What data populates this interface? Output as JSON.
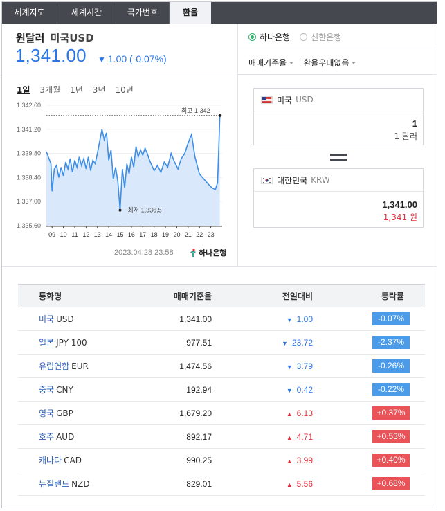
{
  "tabs": [
    {
      "label": "세계지도"
    },
    {
      "label": "세계시간"
    },
    {
      "label": "국가번호"
    },
    {
      "label": "환율"
    }
  ],
  "header": {
    "title": "원달러",
    "subtitle": "미국USD",
    "rate": "1,341.00",
    "change_arrow": "▼",
    "change": "1.00 (-0.07%)",
    "change_color": "#2b76e5"
  },
  "periods": [
    {
      "label": "1일"
    },
    {
      "label": "3개월"
    },
    {
      "label": "1년"
    },
    {
      "label": "3년"
    },
    {
      "label": "10년"
    }
  ],
  "chart_data": {
    "type": "area",
    "x_tick_labels": [
      "09",
      "10",
      "11",
      "12",
      "13",
      "14",
      "15",
      "16",
      "17",
      "18",
      "19",
      "20",
      "21",
      "22",
      "23"
    ],
    "y_tick_labels": [
      "1,342.60",
      "1,341.20",
      "1,339.80",
      "1,338.40",
      "1,337.00",
      "1,335.60"
    ],
    "ylim": [
      1335.6,
      1342.6
    ],
    "xlim": [
      8.5,
      24.0
    ],
    "max_label": "최고 1,342",
    "max_value": 1342.0,
    "min_label": "최저 1,336.5",
    "min_value": 1336.5,
    "min_x": 15.0,
    "series": [
      {
        "x": [
          8.5,
          8.9,
          9.0,
          9.2,
          9.4,
          9.6,
          9.8,
          10.0,
          10.2,
          10.4,
          10.6,
          10.8,
          11.0,
          11.2,
          11.4,
          11.6,
          11.8,
          12.0,
          12.2,
          12.4,
          12.6,
          12.8,
          13.0,
          13.2,
          13.4,
          13.6,
          13.8,
          14.0,
          14.2,
          14.4,
          14.6,
          14.8,
          15.0,
          15.2,
          15.4,
          15.6,
          15.8,
          16.0,
          16.2,
          16.4,
          16.6,
          16.8,
          17.0,
          17.2,
          17.4,
          17.6,
          17.8,
          18.0,
          18.3,
          18.6,
          18.9,
          19.2,
          19.5,
          19.8,
          20.1,
          20.4,
          20.7,
          21.0,
          21.3,
          21.6,
          22.0,
          22.4,
          22.8,
          23.1,
          23.4,
          23.6,
          23.8
        ],
        "y": [
          1339.9,
          1339.2,
          1337.6,
          1338.9,
          1339.1,
          1338.4,
          1339.0,
          1338.5,
          1339.3,
          1338.9,
          1339.5,
          1338.7,
          1339.4,
          1339.0,
          1339.6,
          1339.1,
          1339.5,
          1338.9,
          1339.6,
          1338.8,
          1339.4,
          1339.2,
          1339.8,
          1340.5,
          1341.2,
          1340.6,
          1341.0,
          1339.4,
          1340.0,
          1338.3,
          1339.0,
          1338.2,
          1336.5,
          1338.9,
          1337.8,
          1339.2,
          1338.6,
          1339.6,
          1339.0,
          1340.2,
          1339.6,
          1340.0,
          1339.7,
          1340.1,
          1339.8,
          1339.4,
          1339.1,
          1338.8,
          1339.1,
          1338.7,
          1339.3,
          1339.0,
          1339.8,
          1339.3,
          1338.9,
          1339.5,
          1339.8,
          1340.4,
          1340.9,
          1339.6,
          1338.6,
          1338.3,
          1338.0,
          1337.8,
          1337.7,
          1338.1,
          1342.0
        ]
      }
    ],
    "colors": {
      "line": "#3e8ee6",
      "fill": "#d9e9fb",
      "max_line": "#333333"
    }
  },
  "chart_footer": {
    "timestamp": "2023.04.28 23:58",
    "bank_logo": "하나은행"
  },
  "banks": [
    {
      "label": "하나은행",
      "selected": true
    },
    {
      "label": "신한은행",
      "selected": false
    }
  ],
  "selects": [
    {
      "label": "매매기준율"
    },
    {
      "label": "환율우대없음"
    }
  ],
  "converter": {
    "from": {
      "country": "미국",
      "code": "USD",
      "amount": "1",
      "unit": "1 달러",
      "flag": "us-flag"
    },
    "to": {
      "country": "대한민국",
      "code": "KRW",
      "amount": "1,341.00",
      "unit": "1,341 원",
      "flag": "kr-flag",
      "unit_color": "#e2323d"
    }
  },
  "table": {
    "headers": [
      "통화명",
      "매매기준율",
      "전일대비",
      "등락률"
    ],
    "rows": [
      {
        "name": "미국",
        "code": "USD",
        "rate": "1,341.00",
        "dir": "down",
        "arrow": "▼",
        "diff": "1.00",
        "pct": "-0.07%"
      },
      {
        "name": "일본",
        "code": "JPY 100",
        "rate": "977.51",
        "dir": "down",
        "arrow": "▼",
        "diff": "23.72",
        "pct": "-2.37%"
      },
      {
        "name": "유럽연합",
        "code": "EUR",
        "rate": "1,474.56",
        "dir": "down",
        "arrow": "▼",
        "diff": "3.79",
        "pct": "-0.26%"
      },
      {
        "name": "중국",
        "code": "CNY",
        "rate": "192.94",
        "dir": "down",
        "arrow": "▼",
        "diff": "0.42",
        "pct": "-0.22%"
      },
      {
        "name": "영국",
        "code": "GBP",
        "rate": "1,679.20",
        "dir": "up",
        "arrow": "▲",
        "diff": "6.13",
        "pct": "+0.37%"
      },
      {
        "name": "호주",
        "code": "AUD",
        "rate": "892.17",
        "dir": "up",
        "arrow": "▲",
        "diff": "4.71",
        "pct": "+0.53%"
      },
      {
        "name": "캐나다",
        "code": "CAD",
        "rate": "990.25",
        "dir": "up",
        "arrow": "▲",
        "diff": "3.99",
        "pct": "+0.40%"
      },
      {
        "name": "뉴질랜드",
        "code": "NZD",
        "rate": "829.01",
        "dir": "up",
        "arrow": "▲",
        "diff": "5.56",
        "pct": "+0.68%"
      }
    ]
  }
}
